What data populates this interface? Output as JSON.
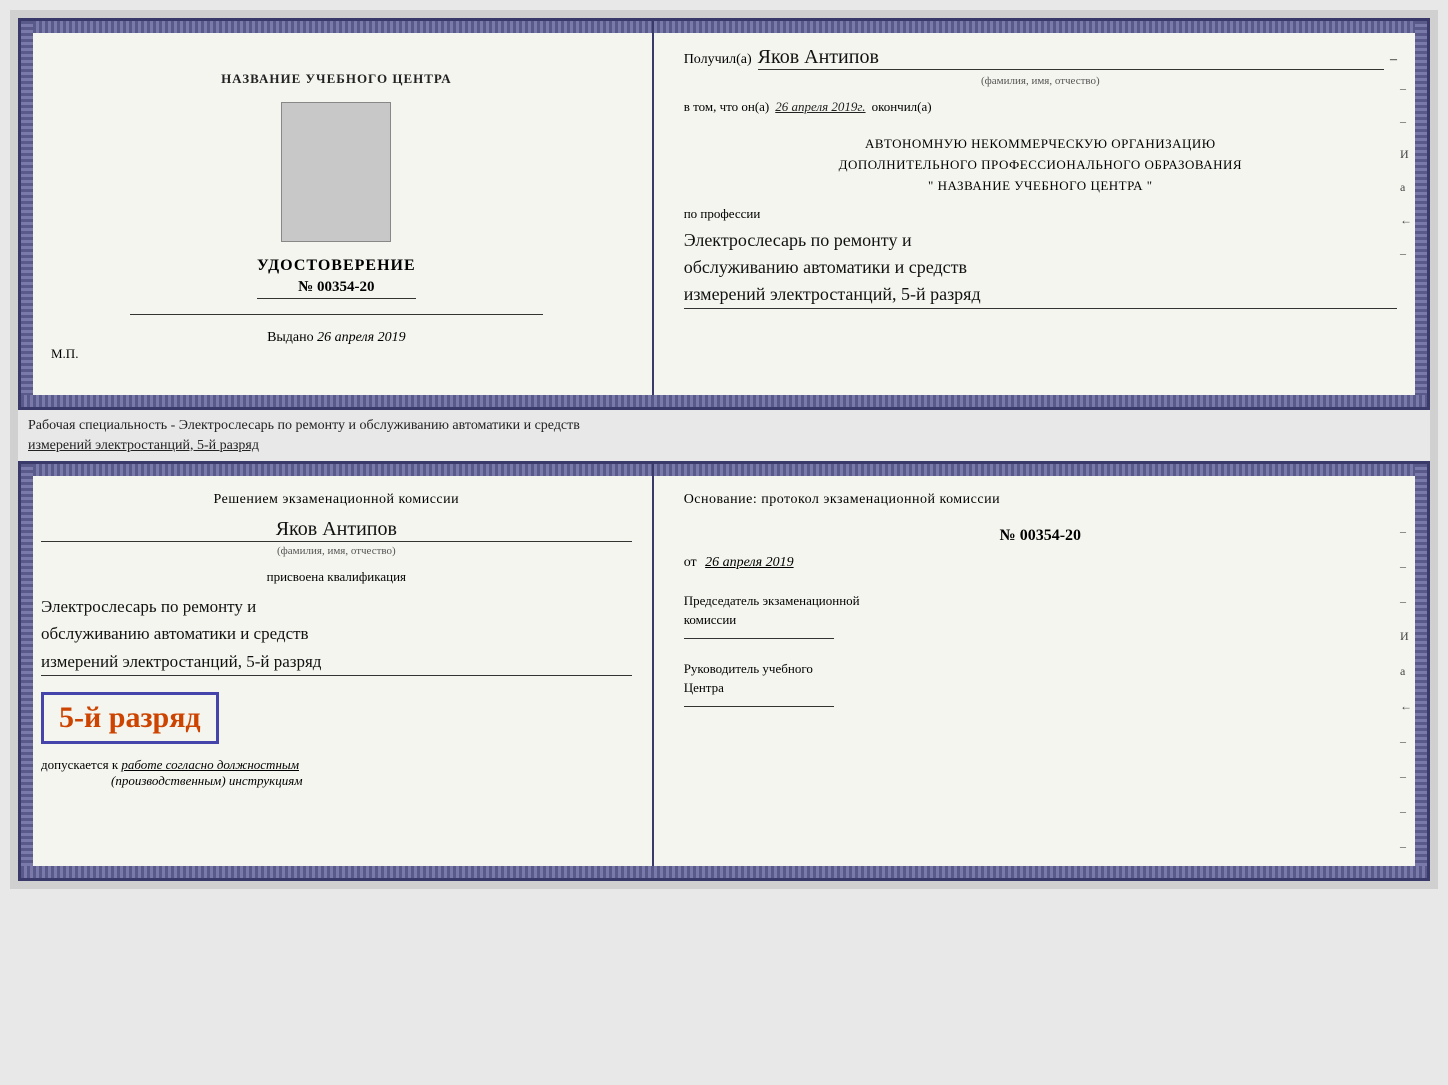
{
  "top_cert": {
    "left": {
      "org_name": "НАЗВАНИЕ УЧЕБНОГО ЦЕНТРА",
      "label_udostoverenie": "УДОСТОВЕРЕНИЕ",
      "label_number": "№ 00354-20",
      "label_vydano": "Выдано",
      "date_vydano": "26 апреля 2019",
      "mp": "М.П."
    },
    "right": {
      "label_poluchil": "Получил(а)",
      "fio_value": "Яков Антипов",
      "label_fio_sub": "(фамилия, имя, отчество)",
      "label_vtom": "в том, что он(а)",
      "date_vtom": "26 апреля 2019г.",
      "label_okonchil": "окончил(а)",
      "org_line1": "АВТОНОМНУЮ НЕКОММЕРЧЕСКУЮ ОРГАНИЗАЦИЮ",
      "org_line2": "ДОПОЛНИТЕЛЬНОГО ПРОФЕССИОНАЛЬНОГО ОБРАЗОВАНИЯ",
      "org_line3": "\"   НАЗВАНИЕ УЧЕБНОГО ЦЕНТРА   \"",
      "label_po_professii": "по профессии",
      "profession_line1": "Электрослесарь по ремонту и",
      "profession_line2": "обслуживанию автоматики и средств",
      "profession_line3": "измерений электростанций, 5-й разряд",
      "side_chars": [
        "–",
        "–",
        "И",
        "а",
        "←",
        "–"
      ]
    }
  },
  "middle_text": {
    "line1": "Рабочая специальность - Электрослесарь по ремонту и обслуживанию автоматики и средств",
    "line2": "измерений электростанций, 5-й разряд"
  },
  "bottom_cert": {
    "left": {
      "resheniem": "Решением экзаменационной комиссии",
      "fio_value": "Яков Антипов",
      "label_fio_sub": "(фамилия, имя, отчество)",
      "label_prisvoena": "присвоена квалификация",
      "qualification_line1": "Электрослесарь по ремонту и",
      "qualification_line2": "обслуживанию автоматики и средств",
      "qualification_line3": "измерений электростанций, 5-й разряд",
      "razryad_text": "5-й разряд",
      "label_dopuskaetsya": "допускается к",
      "dopusk_italic": "работе согласно должностным",
      "dopusk_italic2": "(производственным) инструкциям"
    },
    "right": {
      "label_osnovanie": "Основание: протокол экзаменационной комиссии",
      "number": "№  00354-20",
      "label_ot": "от",
      "date_ot": "26 апреля 2019",
      "label_predsedatel": "Председатель экзаменационной",
      "label_predsedatel2": "комиссии",
      "label_rukovoditel": "Руководитель учебного",
      "label_rukovoditel2": "Центра",
      "side_chars": [
        "–",
        "–",
        "–",
        "И",
        "а",
        "←",
        "–",
        "–",
        "–",
        "–"
      ]
    }
  }
}
